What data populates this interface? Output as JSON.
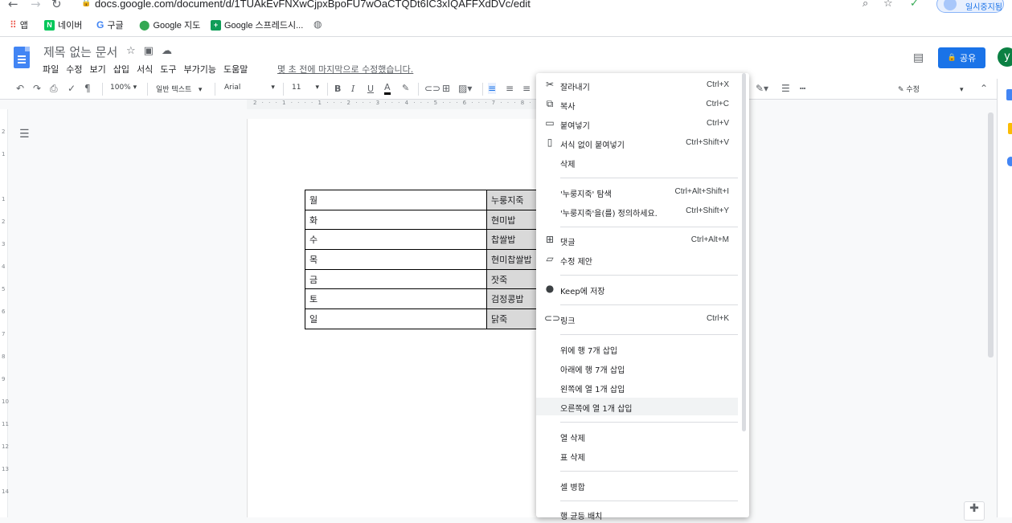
{
  "browser": {
    "url": "docs.google.com/document/d/1TUAkEvFNXwCjpxBpoFU7wOaCTQDt6IC3xIQAFFXdDVc/edit",
    "profile_label": "일시중지됨"
  },
  "bookmarks": [
    {
      "label": "앱",
      "color": "#ea4335"
    },
    {
      "label": "네이버",
      "color": "#03c75a",
      "glyph": "N"
    },
    {
      "label": "구글",
      "color": "#4285f4",
      "glyph": "G"
    },
    {
      "label": "Google 지도",
      "color": "#34a853"
    },
    {
      "label": "Google 스프레드시...",
      "color": "#0f9d58",
      "glyph": "+"
    }
  ],
  "doc": {
    "title": "제목 없는 문서",
    "last_edit": "몇 초 전에 마지막으로 수정했습니다.",
    "share_label": "공유",
    "user_initial": "y"
  },
  "menus": [
    "파일",
    "수정",
    "보기",
    "삽입",
    "서식",
    "도구",
    "부가기능",
    "도움말"
  ],
  "toolbar": {
    "zoom": "100%",
    "style": "일반 텍스트",
    "font": "Arial",
    "size": "11",
    "mode": "수정"
  },
  "ruler": "2 · · · 1 · · · · 1 · · · 2 · · · 3 · · · 4 · · · 5 · · · 6 · · · 7 · · · 8 · · · 9 · · · 10",
  "vruler": [
    "2",
    "1",
    "1",
    "2",
    "3",
    "4",
    "5",
    "6",
    "7",
    "8",
    "9",
    "10",
    "11",
    "12",
    "13",
    "14"
  ],
  "table": [
    [
      "월",
      "누룽지죽"
    ],
    [
      "화",
      "현미밥"
    ],
    [
      "수",
      "찹쌀밥"
    ],
    [
      "목",
      "현미찹쌀밥"
    ],
    [
      "금",
      "잣죽"
    ],
    [
      "토",
      "검정콩밥"
    ],
    [
      "일",
      "닭죽"
    ]
  ],
  "context_menu": {
    "cut": {
      "label": "잘라내기",
      "shortcut": "Ctrl+X"
    },
    "copy": {
      "label": "복사",
      "shortcut": "Ctrl+C"
    },
    "paste": {
      "label": "붙여넣기",
      "shortcut": "Ctrl+V"
    },
    "paste_plain": {
      "label": "서식 없이 붙여넣기",
      "shortcut": "Ctrl+Shift+V"
    },
    "delete": {
      "label": "삭제"
    },
    "explore": {
      "label": "'누룽지죽' 탐색",
      "shortcut": "Ctrl+Alt+Shift+I"
    },
    "define": {
      "label": "'누룽지죽'을(를) 정의하세요.",
      "shortcut": "Ctrl+Shift+Y"
    },
    "comment": {
      "label": "댓글",
      "shortcut": "Ctrl+Alt+M"
    },
    "suggest": {
      "label": "수정 제안"
    },
    "keep": {
      "label": "Keep에 저장"
    },
    "link": {
      "label": "링크",
      "shortcut": "Ctrl+K"
    },
    "row_above": {
      "label": "위에 행 7개 삽입"
    },
    "row_below": {
      "label": "아래에 행 7개 삽입"
    },
    "col_left": {
      "label": "왼쪽에 열 1개 삽입"
    },
    "col_right": {
      "label": "오른쪽에 열 1개 삽입"
    },
    "del_col": {
      "label": "열 삭제"
    },
    "del_table": {
      "label": "표 삭제"
    },
    "merge": {
      "label": "셀 병합"
    },
    "distribute": {
      "label": "행 균등 배치"
    }
  }
}
